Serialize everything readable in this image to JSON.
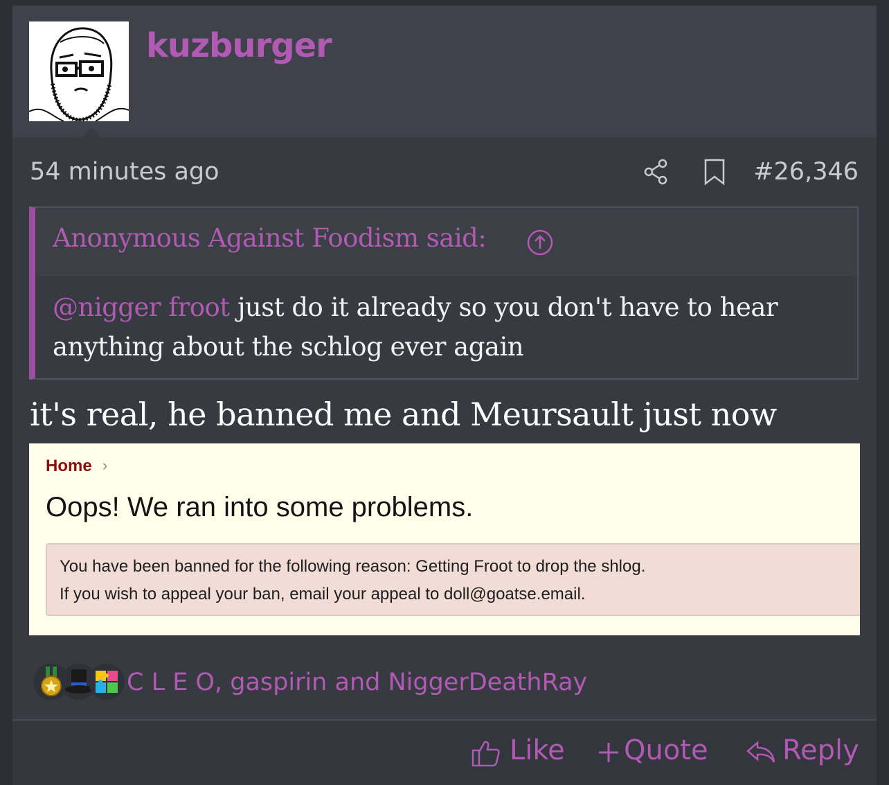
{
  "post": {
    "username": "kuzburger",
    "time_ago": "54 minutes ago",
    "post_number": "#26,346",
    "quote": {
      "author_said": "Anonymous Against Foodism said:",
      "mention": "@nigger froot",
      "text": " just do it already so you don't have to hear anything about the schlog ever again"
    },
    "body_text": "it's real, he banned me and Meursault just now",
    "embedded_screenshot": {
      "breadcrumb": "Home",
      "breadcrumb_sep": "›",
      "title": "Oops! We ran into some problems.",
      "notice_line1": "You have been banned for the following reason: Getting Froot to drop the shlog.",
      "notice_line2": "If you wish to appeal your ban, email your appeal to doll@goatse.email."
    },
    "reactions": {
      "icons": [
        "medal-icon",
        "top-hat-icon",
        "puzzle-icon"
      ],
      "users": "C L E O, gaspirin and NiggerDeathRay"
    },
    "actions": {
      "like": "Like",
      "quote": "Quote",
      "reply": "Reply"
    }
  },
  "colors": {
    "accent": "#b15ab4",
    "background": "#373a41",
    "header": "#3f424a"
  }
}
